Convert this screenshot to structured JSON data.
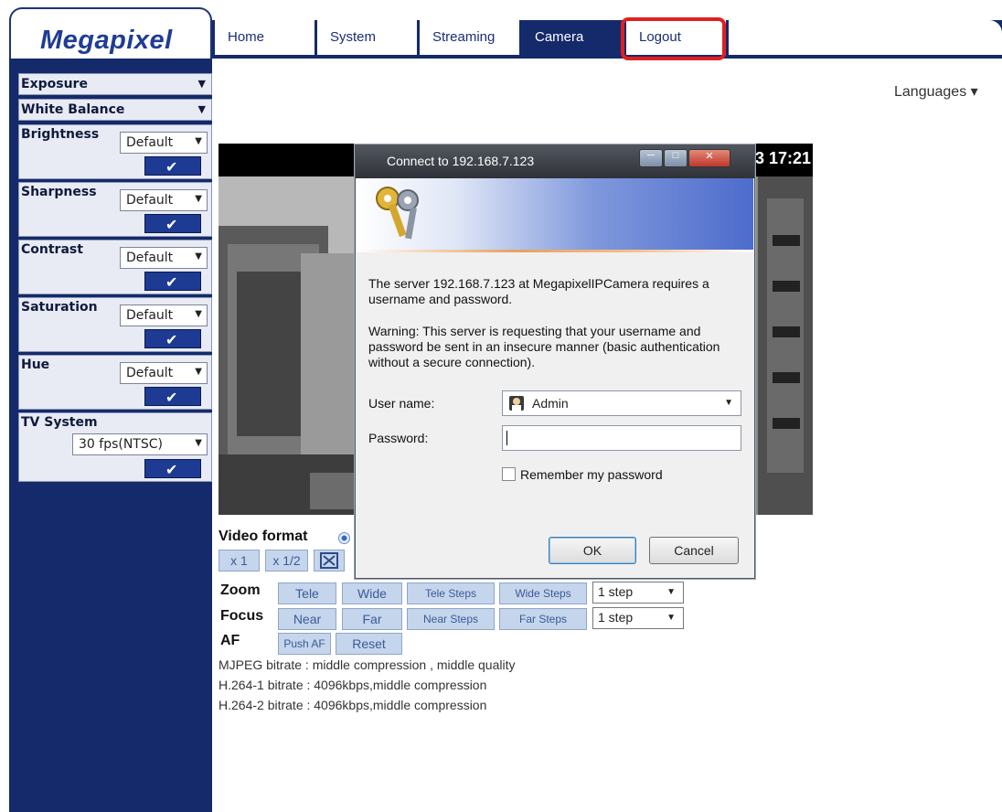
{
  "brand": {
    "logo_text": "Megapixel"
  },
  "nav": {
    "tabs": [
      {
        "label": "Home"
      },
      {
        "label": "System"
      },
      {
        "label": "Streaming"
      },
      {
        "label": "Camera",
        "active": true
      },
      {
        "label": "Logout",
        "highlighted": true
      }
    ]
  },
  "sidebar": {
    "exposure": "Exposure",
    "white_balance": "White Balance",
    "brightness": {
      "label": "Brightness",
      "value": "Default"
    },
    "sharpness": {
      "label": "Sharpness",
      "value": "Default"
    },
    "contrast": {
      "label": "Contrast",
      "value": "Default"
    },
    "saturation": {
      "label": "Saturation",
      "value": "Default"
    },
    "hue": {
      "label": "Hue",
      "value": "Default"
    },
    "tv_system": {
      "label": "TV System",
      "value": "30 fps(NTSC)"
    }
  },
  "languages_label": "Languages ▾",
  "video": {
    "time_text": "3 17:21"
  },
  "controls": {
    "video_format_label": "Video format",
    "scale_buttons": [
      "x 1",
      "x 1/2"
    ],
    "zoom": {
      "label": "Zoom",
      "tele": "Tele",
      "wide": "Wide",
      "tele_steps": "Tele Steps",
      "wide_steps": "Wide Steps",
      "step_value": "1 step"
    },
    "focus": {
      "label": "Focus",
      "near": "Near",
      "far": "Far",
      "near_steps": "Near Steps",
      "far_steps": "Far Steps",
      "step_value": "1 step"
    },
    "af": {
      "label": "AF",
      "push_af": "Push AF",
      "reset": "Reset"
    }
  },
  "info_lines": [
    "MJPEG bitrate : middle compression , middle quality",
    "H.264-1 bitrate : 4096kbps,middle compression",
    "H.264-2 bitrate : 4096kbps,middle compression"
  ],
  "dialog": {
    "title": "Connect to 192.168.7.123",
    "message": "The server 192.168.7.123 at MegapixelIPCamera requires a username and password.",
    "warning": "Warning: This server is requesting that your username and password be sent in an insecure manner (basic authentication without a secure connection).",
    "username_label": "User name:",
    "username_value": "Admin",
    "password_label": "Password:",
    "password_value": "",
    "remember_label": "Remember my password",
    "ok_label": "OK",
    "cancel_label": "Cancel"
  },
  "colors": {
    "navy": "#142a6b",
    "logo_blue": "#1f3c96",
    "highlight_red": "#e02020",
    "button_blue": "#c5d5eb"
  }
}
